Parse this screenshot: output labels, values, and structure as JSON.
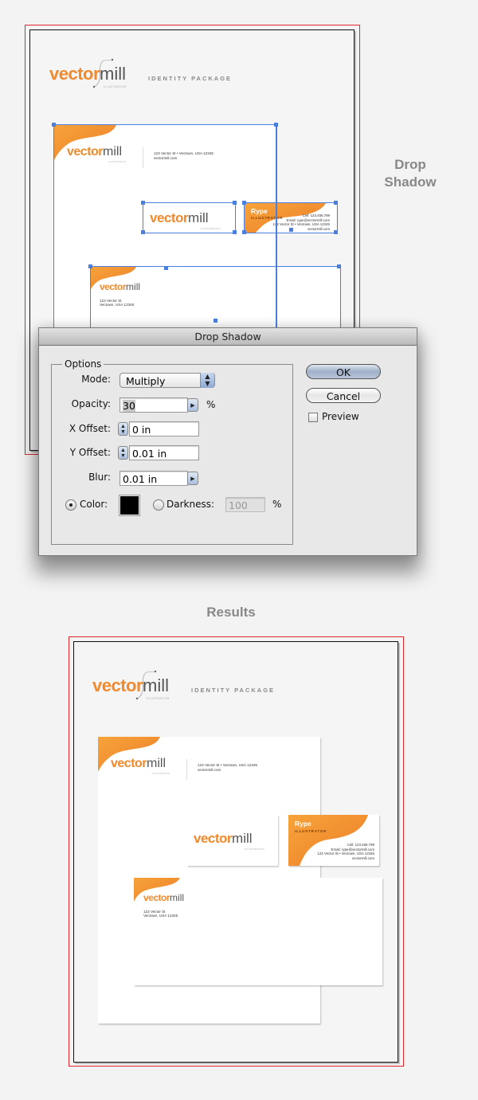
{
  "side_heading": "Drop\nShadow",
  "results_heading": "Results",
  "logo": {
    "vector": "vector",
    "mill": "mill",
    "tagline": "ILLUSTRATION"
  },
  "identity_package_label": "IDENTITY PACKAGE",
  "letterhead": {
    "address_line": "123 Vector St • Vectown, USA 12345",
    "website": "vectormill.com"
  },
  "business_card": {
    "name": "Rype",
    "role": "ILLUSTRATOR",
    "cell": "Cell: 123.456.789",
    "email": "Email: rype@vectormill.com",
    "address": "123 Vector St • Vectown, USA 12345",
    "website": "vectormill.com"
  },
  "envelope": {
    "address_line1": "123 Vector St",
    "address_line2": "Vectown, USA 12345"
  },
  "colors": {
    "brand_orange": "#f08a2c",
    "selection_blue": "#4a7fe0",
    "bleed_red": "#e0262a"
  },
  "dialog": {
    "title": "Drop Shadow",
    "group_label": "Options",
    "mode_label": "Mode:",
    "mode_value": "Multiply",
    "opacity_label": "Opacity:",
    "opacity_value": "30",
    "opacity_unit": "%",
    "x_offset_label": "X Offset:",
    "x_offset_value": "0 in",
    "y_offset_label": "Y Offset:",
    "y_offset_value": "0.01 in",
    "blur_label": "Blur:",
    "blur_value": "0.01 in",
    "color_label": "Color:",
    "color_selected": true,
    "color_value": "#000000",
    "darkness_label": "Darkness:",
    "darkness_value": "100",
    "darkness_unit": "%",
    "ok_label": "OK",
    "cancel_label": "Cancel",
    "preview_label": "Preview",
    "preview_checked": false
  }
}
